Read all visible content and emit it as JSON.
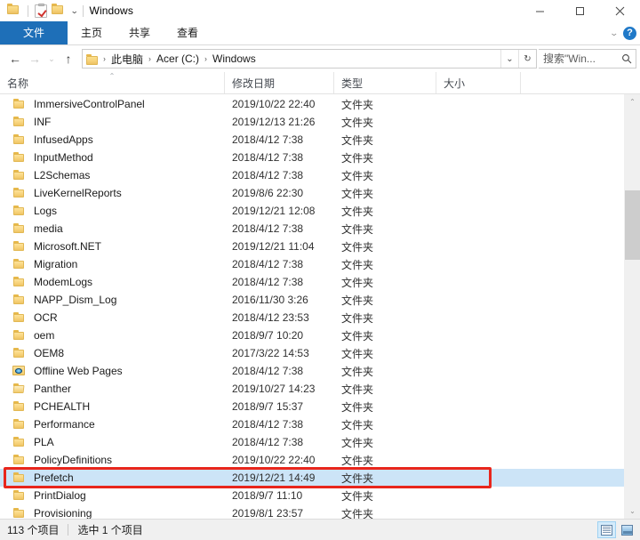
{
  "window": {
    "title": "Windows",
    "quick_access": [
      {
        "name": "folder-icon",
        "label": "Windows"
      },
      {
        "name": "properties-icon",
        "label": "属性"
      },
      {
        "name": "new-folder-icon",
        "label": "新建文件夹"
      },
      {
        "name": "chevron-down-icon",
        "label": "自定义快速访问工具栏"
      }
    ],
    "controls": {
      "minimize": "最小化",
      "maximize": "最大化",
      "close": "关闭"
    }
  },
  "ribbon": {
    "tabs": [
      {
        "label": "文件",
        "active": true
      },
      {
        "label": "主页",
        "active": false
      },
      {
        "label": "共享",
        "active": false
      },
      {
        "label": "查看",
        "active": false
      }
    ],
    "expand_caret": "⌄",
    "help_label": "?"
  },
  "navbar": {
    "back": "←",
    "forward": "→",
    "recent": "⌄",
    "up": "↑",
    "breadcrumb": {
      "icon": "folder-icon",
      "parts": [
        "此电脑",
        "Acer (C:)",
        "Windows"
      ],
      "separator": "›"
    },
    "dropdown": "⌄",
    "refresh": "↻",
    "refresh_title": "刷新"
  },
  "search": {
    "placeholder": "搜索\"Win...",
    "value": "",
    "icon": "search-icon"
  },
  "columns": [
    {
      "key": "name",
      "label": "名称",
      "sorted": true,
      "sort_caret": "⌃"
    },
    {
      "key": "date",
      "label": "修改日期",
      "sorted": false
    },
    {
      "key": "type",
      "label": "类型",
      "sorted": false
    },
    {
      "key": "size",
      "label": "大小",
      "sorted": false
    }
  ],
  "files": [
    {
      "name": "ImmersiveControlPanel",
      "date": "2019/10/22 22:40",
      "type": "文件夹",
      "size": "",
      "icon": "folder",
      "selected": false
    },
    {
      "name": "INF",
      "date": "2019/12/13 21:26",
      "type": "文件夹",
      "size": "",
      "icon": "folder",
      "selected": false
    },
    {
      "name": "InfusedApps",
      "date": "2018/4/12 7:38",
      "type": "文件夹",
      "size": "",
      "icon": "folder",
      "selected": false
    },
    {
      "name": "InputMethod",
      "date": "2018/4/12 7:38",
      "type": "文件夹",
      "size": "",
      "icon": "folder",
      "selected": false
    },
    {
      "name": "L2Schemas",
      "date": "2018/4/12 7:38",
      "type": "文件夹",
      "size": "",
      "icon": "folder",
      "selected": false
    },
    {
      "name": "LiveKernelReports",
      "date": "2019/8/6 22:30",
      "type": "文件夹",
      "size": "",
      "icon": "folder",
      "selected": false
    },
    {
      "name": "Logs",
      "date": "2019/12/21 12:08",
      "type": "文件夹",
      "size": "",
      "icon": "folder",
      "selected": false
    },
    {
      "name": "media",
      "date": "2018/4/12 7:38",
      "type": "文件夹",
      "size": "",
      "icon": "folder",
      "selected": false
    },
    {
      "name": "Microsoft.NET",
      "date": "2019/12/21 11:04",
      "type": "文件夹",
      "size": "",
      "icon": "folder",
      "selected": false
    },
    {
      "name": "Migration",
      "date": "2018/4/12 7:38",
      "type": "文件夹",
      "size": "",
      "icon": "folder",
      "selected": false
    },
    {
      "name": "ModemLogs",
      "date": "2018/4/12 7:38",
      "type": "文件夹",
      "size": "",
      "icon": "folder",
      "selected": false
    },
    {
      "name": "NAPP_Dism_Log",
      "date": "2016/11/30 3:26",
      "type": "文件夹",
      "size": "",
      "icon": "folder",
      "selected": false
    },
    {
      "name": "OCR",
      "date": "2018/4/12 23:53",
      "type": "文件夹",
      "size": "",
      "icon": "folder",
      "selected": false
    },
    {
      "name": "oem",
      "date": "2018/9/7 10:20",
      "type": "文件夹",
      "size": "",
      "icon": "folder",
      "selected": false
    },
    {
      "name": "OEM8",
      "date": "2017/3/22 14:53",
      "type": "文件夹",
      "size": "",
      "icon": "folder",
      "selected": false
    },
    {
      "name": "Offline Web Pages",
      "date": "2018/4/12 7:38",
      "type": "文件夹",
      "size": "",
      "icon": "web",
      "selected": false
    },
    {
      "name": "Panther",
      "date": "2019/10/27 14:23",
      "type": "文件夹",
      "size": "",
      "icon": "folder-open",
      "selected": false
    },
    {
      "name": "PCHEALTH",
      "date": "2018/9/7 15:37",
      "type": "文件夹",
      "size": "",
      "icon": "folder",
      "selected": false
    },
    {
      "name": "Performance",
      "date": "2018/4/12 7:38",
      "type": "文件夹",
      "size": "",
      "icon": "folder",
      "selected": false
    },
    {
      "name": "PLA",
      "date": "2018/4/12 7:38",
      "type": "文件夹",
      "size": "",
      "icon": "folder",
      "selected": false
    },
    {
      "name": "PolicyDefinitions",
      "date": "2019/10/22 22:40",
      "type": "文件夹",
      "size": "",
      "icon": "folder",
      "selected": false
    },
    {
      "name": "Prefetch",
      "date": "2019/12/21 14:49",
      "type": "文件夹",
      "size": "",
      "icon": "folder",
      "selected": true
    },
    {
      "name": "PrintDialog",
      "date": "2018/9/7 11:10",
      "type": "文件夹",
      "size": "",
      "icon": "folder",
      "selected": false
    },
    {
      "name": "Provisioning",
      "date": "2019/8/1 23:57",
      "type": "文件夹",
      "size": "",
      "icon": "folder",
      "selected": false
    }
  ],
  "annotation": {
    "color": "#e8261c",
    "target": "Prefetch"
  },
  "scrollbar": {
    "up_arrow": "⌃",
    "down_arrow": "⌄"
  },
  "statusbar": {
    "item_count": "113 个项目",
    "selection": "选中 1 个项目",
    "views": [
      {
        "name": "details-view-button",
        "label": "详细信息",
        "active": true
      },
      {
        "name": "large-icons-view-button",
        "label": "大图标",
        "active": false
      }
    ]
  }
}
